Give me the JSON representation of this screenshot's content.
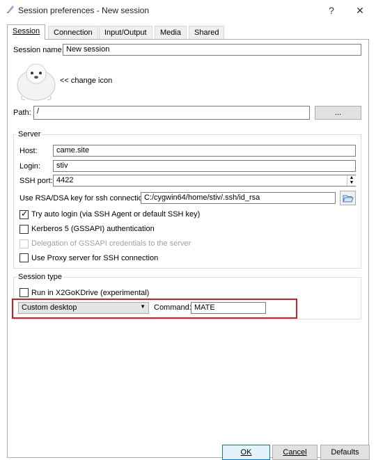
{
  "window": {
    "title": "Session preferences - New session",
    "help_label": "?",
    "close_label": "✕"
  },
  "tabs": [
    {
      "label": "Session",
      "active": true
    },
    {
      "label": "Connection",
      "active": false
    },
    {
      "label": "Input/Output",
      "active": false
    },
    {
      "label": "Media",
      "active": false
    },
    {
      "label": "Shared folders",
      "active": false
    }
  ],
  "session": {
    "name_label": "Session name:",
    "name_value": "New session",
    "change_icon_label": "<< change icon",
    "path_label": "Path:",
    "path_value": "/",
    "path_browse_label": "..."
  },
  "server": {
    "title": "Server",
    "host_label": "Host:",
    "host_value": "came.site",
    "login_label": "Login:",
    "login_value": "stiv",
    "ssh_port_label": "SSH port:",
    "ssh_port_value": "4422",
    "rsa_label": "Use RSA/DSA key for ssh connection:",
    "rsa_value": "C:/cygwin64/home/stiv/.ssh/id_rsa",
    "auto_login_label": "Try auto login (via SSH Agent or default SSH key)",
    "auto_login_checked": true,
    "kerberos_label": "Kerberos 5 (GSSAPI) authentication",
    "kerberos_checked": false,
    "delegation_label": "Delegation of GSSAPI credentials to the server",
    "delegation_checked": false,
    "proxy_label": "Use Proxy server for SSH connection",
    "proxy_checked": false
  },
  "session_type": {
    "title": "Session type",
    "run_in_x2go_label": "Run in X2GoKDrive (experimental)",
    "run_in_x2go_checked": false,
    "type_value": "Custom desktop",
    "command_label": "Command:",
    "command_value": "MATE"
  },
  "buttons": {
    "ok": "OK",
    "cancel": "Cancel",
    "defaults": "Defaults"
  },
  "colors": {
    "highlight": "#cc1f2b",
    "accent": "#0078d7"
  }
}
